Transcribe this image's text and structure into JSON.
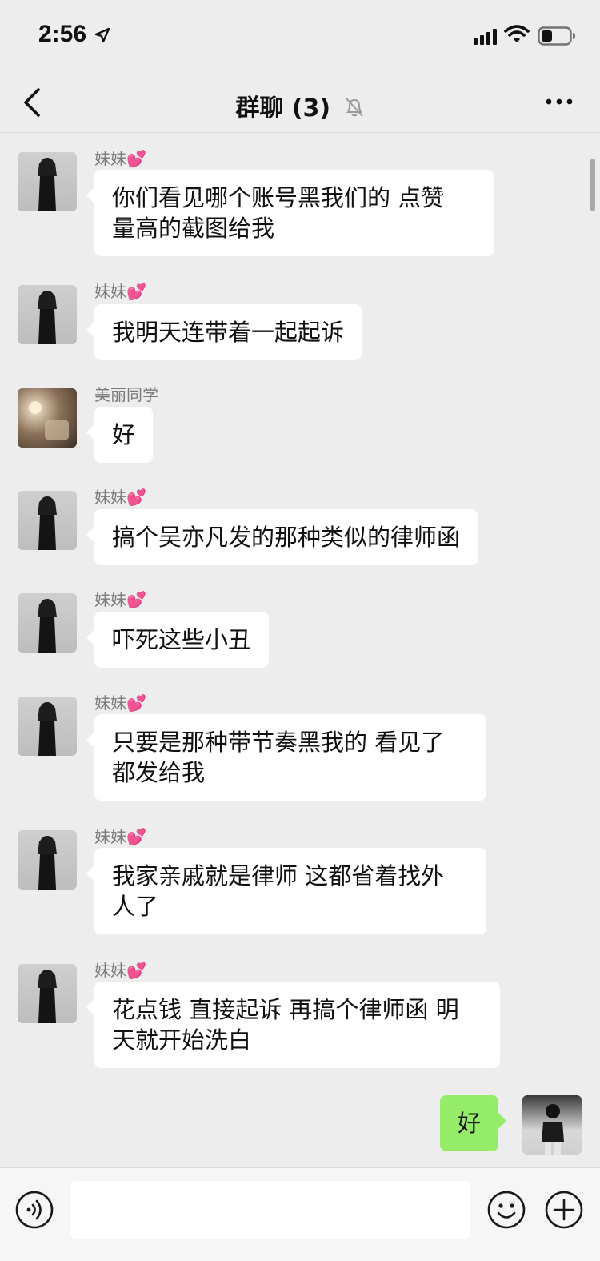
{
  "status_bar": {
    "time": "2:56"
  },
  "header": {
    "title": "群聊 (3)"
  },
  "messages": [
    {
      "sender": "妹妹",
      "sender_emoji": "💕",
      "avatar": "sister",
      "lines": [
        "你们看见哪个账号黑我们的 点赞",
        "量高的截图给我"
      ]
    },
    {
      "sender": "妹妹",
      "sender_emoji": "💕",
      "avatar": "sister",
      "lines": [
        "我明天连带着一起起诉"
      ]
    },
    {
      "sender": "美丽同学",
      "sender_emoji": "",
      "avatar": "classmate",
      "lines": [
        "好"
      ]
    },
    {
      "sender": "妹妹",
      "sender_emoji": "💕",
      "avatar": "sister",
      "lines": [
        "搞个吴亦凡发的那种类似的律师函"
      ]
    },
    {
      "sender": "妹妹",
      "sender_emoji": "💕",
      "avatar": "sister",
      "lines": [
        "吓死这些小丑"
      ]
    },
    {
      "sender": "妹妹",
      "sender_emoji": "💕",
      "avatar": "sister",
      "lines": [
        "只要是那种带节奏黑我的 看见了",
        "都发给我"
      ]
    },
    {
      "sender": "妹妹",
      "sender_emoji": "💕",
      "avatar": "sister",
      "lines": [
        "我家亲戚就是律师 这都省着找外",
        "人了"
      ]
    },
    {
      "sender": "妹妹",
      "sender_emoji": "💕",
      "avatar": "sister",
      "lines": [
        "花点钱 直接起诉 再搞个律师函 明",
        "天就开始洗白"
      ]
    }
  ],
  "self_message": {
    "text": "好"
  },
  "input": {
    "value": ""
  },
  "colors": {
    "background": "#ededed",
    "self_bubble": "#95ec69",
    "other_bubble": "#ffffff",
    "sender_heart": "#ff5aa0"
  }
}
